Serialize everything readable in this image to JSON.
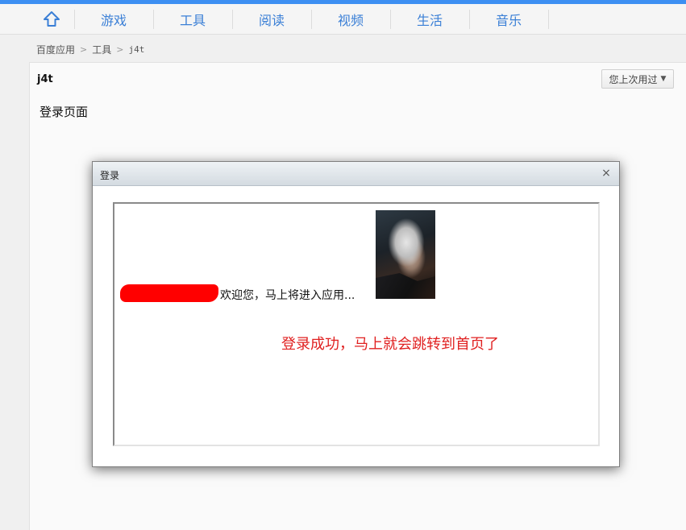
{
  "nav": {
    "home_icon": "home-outline-icon",
    "items": [
      {
        "label": "游戏"
      },
      {
        "label": "工具"
      },
      {
        "label": "阅读"
      },
      {
        "label": "视频"
      },
      {
        "label": "生活"
      },
      {
        "label": "音乐"
      }
    ]
  },
  "breadcrumb": {
    "items": [
      "百度应用",
      "工具",
      "j4t"
    ],
    "separator": ">"
  },
  "app": {
    "title": "j4t",
    "last_used_label": "您上次用过",
    "last_used_arrow": "▼",
    "page_label": "登录页面"
  },
  "dialog": {
    "title": "登录",
    "close": "×",
    "welcome": "欢迎您，马上将进入应用...",
    "success": "登录成功，马上就会跳转到首页了",
    "avatar_icon": "user-avatar-image",
    "redacted_color": "#ff0000"
  },
  "colors": {
    "accent": "#3d8ff2",
    "nav_text": "#3a7fd6",
    "success_text": "#e02020"
  }
}
